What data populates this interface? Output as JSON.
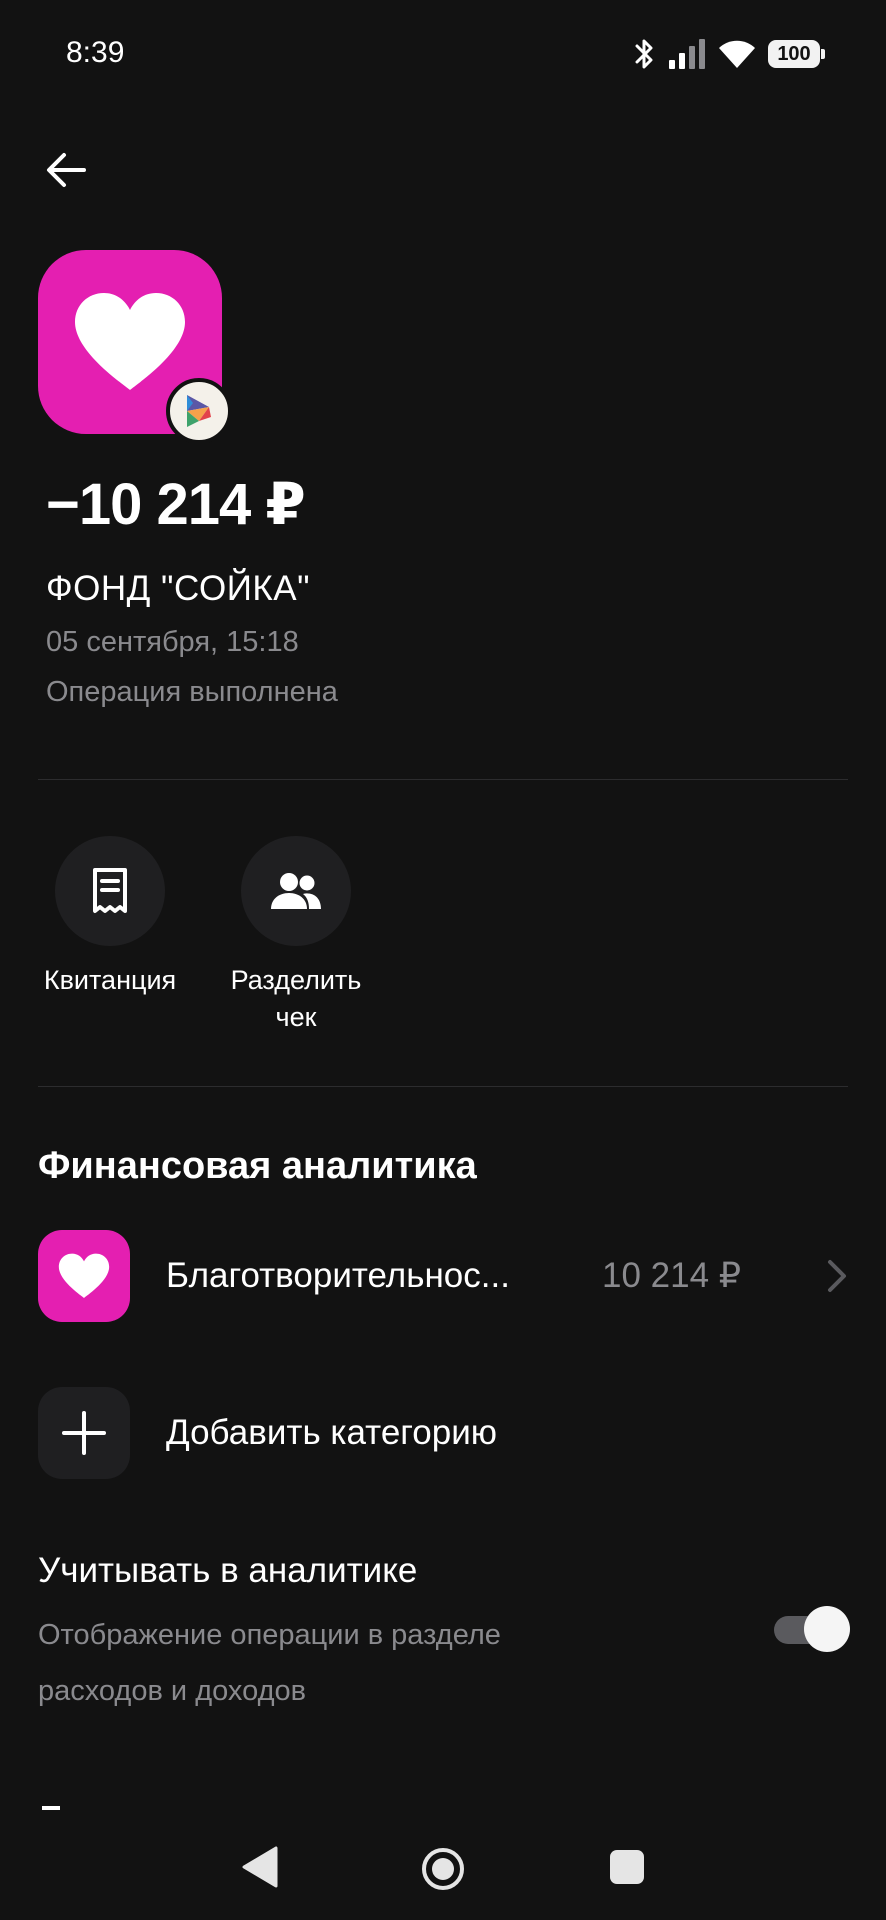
{
  "status_bar": {
    "time": "8:39",
    "battery": "100",
    "icons": [
      "bluetooth-icon",
      "signal-icon",
      "wifi-icon",
      "battery-icon"
    ]
  },
  "header": {
    "back_icon": "arrow-left-icon"
  },
  "transaction": {
    "icon": "heart-icon",
    "icon_color": "#e41fb1",
    "badge_icon": "payment-system-icon",
    "amount": "−10 214 ₽",
    "merchant": "ФОНД \"СОЙКА\"",
    "date": "05 сентября, 15:18",
    "status": "Операция выполнена"
  },
  "actions": [
    {
      "label": "Квитанция",
      "icon": "receipt-icon"
    },
    {
      "label": "Разделить\nчек",
      "icon": "people-icon"
    }
  ],
  "analytics": {
    "title": "Финансовая аналитика",
    "category": {
      "name": "Благотворительнос...",
      "amount": "10 214 ₽",
      "icon": "heart-icon"
    },
    "add_category_label": "Добавить категорию",
    "include": {
      "title": "Учитывать в аналитике",
      "description": "Отображение операции в разделе расходов и доходов",
      "enabled": true
    }
  },
  "nav_bar": {
    "icons": [
      "nav-back-icon",
      "nav-home-icon",
      "nav-recents-icon"
    ]
  }
}
